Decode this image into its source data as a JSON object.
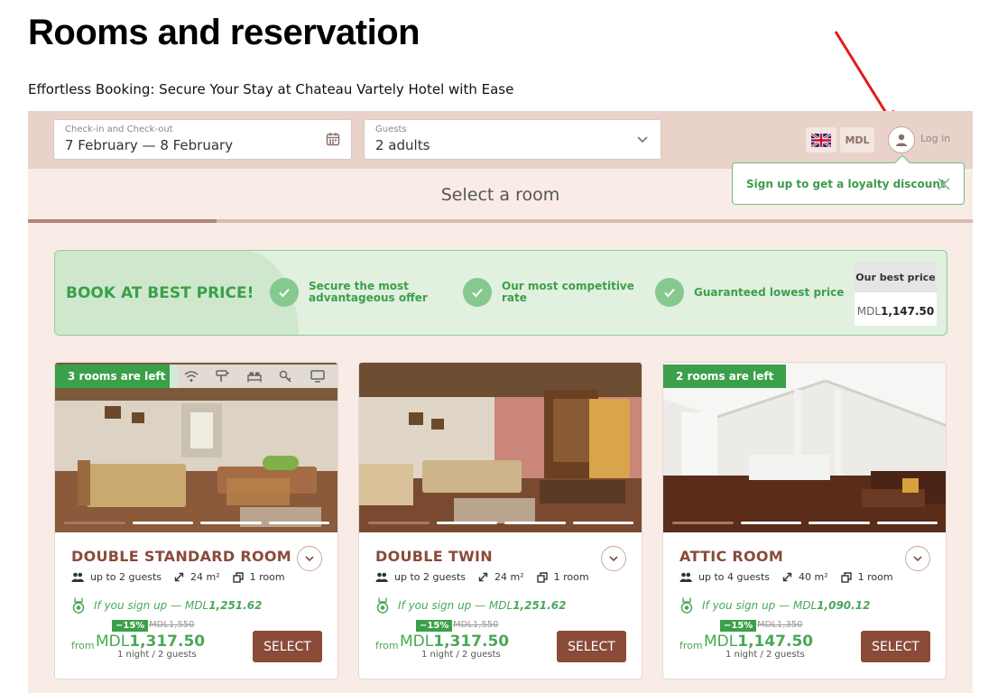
{
  "page": {
    "title": "Rooms and reservation",
    "subtitle": "Effortless Booking: Secure Your Stay at Chateau Vartely Hotel with Ease"
  },
  "colors": {
    "accent_brown": "#8a4b39",
    "accent_green": "#3ba04a",
    "topbar_bg": "#e8d2ca",
    "page_bg": "#f9ece6"
  },
  "search": {
    "dates_label": "Check-in and Check-out",
    "dates_value": "7 February — 8 February",
    "dates_icon": "calendar-icon",
    "guests_label": "Guests",
    "guests_value": "2 adults",
    "guests_icon": "chevron-down-icon"
  },
  "header_controls": {
    "language_icon": "uk-flag-icon",
    "currency": "MDL",
    "account_icon": "user-icon",
    "login_label": "Log in"
  },
  "loyalty_popup": {
    "text": "Sign up to get a loyalty discount",
    "close_icon": "close-icon"
  },
  "steps": {
    "title": "Select a room",
    "progress": 0.2
  },
  "promo": {
    "headline": "BOOK AT BEST PRICE!",
    "benefits": [
      {
        "line1": "Secure the most",
        "line2": "advantageous offer"
      },
      {
        "line1": "Our most competitive",
        "line2": "rate"
      },
      {
        "line1": "Guaranteed lowest price",
        "line2": ""
      }
    ],
    "best_price_label": "Our best price",
    "best_price_currency": "MDL",
    "best_price_amount": "1,147.50"
  },
  "rooms": [
    {
      "badge": "3 rooms are left",
      "name": "DOUBLE STANDARD ROOM",
      "guests": "up to 2 guests",
      "area": "24 m²",
      "rooms": "1 room",
      "signup_prefix": "If you sign up — MDL",
      "signup_amount": "1,251.62",
      "discount": "−15%",
      "old_price": "MDL1,550",
      "from": "from",
      "currency": "MDL",
      "price": "1,317.50",
      "per": "1 night / 2 guests",
      "select_label": "SELECT"
    },
    {
      "badge": "",
      "name": "DOUBLE TWIN",
      "guests": "up to 2 guests",
      "area": "24 m²",
      "rooms": "1 room",
      "signup_prefix": "If you sign up — MDL",
      "signup_amount": "1,251.62",
      "discount": "−15%",
      "old_price": "MDL1,550",
      "from": "from",
      "currency": "MDL",
      "price": "1,317.50",
      "per": "1 night / 2 guests",
      "select_label": "SELECT"
    },
    {
      "badge": "2 rooms are left",
      "name": "ATTIC ROOM",
      "guests": "up to 4 guests",
      "area": "40 m²",
      "rooms": "1 room",
      "signup_prefix": "If you sign up — MDL",
      "signup_amount": "1,090.12",
      "discount": "−15%",
      "old_price": "MDL1,350",
      "from": "from",
      "currency": "MDL",
      "price": "1,147.50",
      "per": "1 night / 2 guests",
      "select_label": "SELECT"
    }
  ],
  "amenity_icons": [
    "wifi-icon",
    "hair-dryer-icon",
    "bed-icon",
    "key-icon",
    "tv-icon"
  ]
}
